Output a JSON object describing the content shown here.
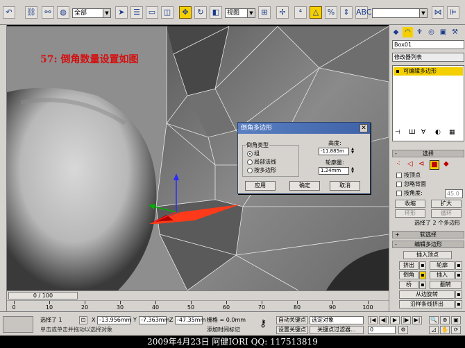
{
  "toolbar": {
    "selection_filter": "全部",
    "ref_coord": "视图",
    "named_selection": ""
  },
  "viewport": {
    "annotation": "57: 倒角数量设置如图"
  },
  "panel": {
    "object_name": "Box01",
    "modifier_list": "修改器列表",
    "stack_item": "可编辑多边形",
    "selection_rollout": "选择",
    "by_vertex": "按顶点",
    "ignore_backfacing": "忽略背面",
    "by_angle": "按角度:",
    "angle_value": "45.0",
    "shrink": "收缩",
    "grow": "扩大",
    "ring": "环形",
    "loop": "循环",
    "selected_info": "选择了 2 个多边形",
    "soft_selection": "软选择",
    "edit_polygons": "编辑多边形",
    "insert_vertex": "插入顶点",
    "extrude": "挤出",
    "outline": "轮廓",
    "bevel": "倒角",
    "inset": "插入",
    "bridge": "桥",
    "flip": "翻转",
    "hinge_from_edge": "从边旋转",
    "extrude_along_spline": "沿样条线挤出"
  },
  "dialog": {
    "title": "倒角多边形",
    "group_label": "倒角类型",
    "option_group": "组",
    "option_local_normal": "局部法线",
    "option_by_polygon": "按多边形",
    "height_label": "高度:",
    "height_value": "-11.885m",
    "outline_label": "轮廓量:",
    "outline_value": "1.24mm",
    "apply": "应用",
    "ok": "确定",
    "cancel": "取消"
  },
  "timeline": {
    "frame": "0 / 100",
    "ticks": [
      "0",
      "10",
      "20",
      "30",
      "40",
      "50",
      "60",
      "70",
      "80",
      "90",
      "100"
    ]
  },
  "status": {
    "selected": "选择了 1",
    "x_value": "-13.956mm",
    "y_value": "-7.363mm",
    "z_value": "-47.35mm",
    "grid": "栅格 = 0.0mm",
    "auto_key": "自动关键点",
    "set_key": "设置关键点",
    "key_filter_select": "选定对象",
    "key_filters": "关键点过滤器...",
    "add_time_tag": "添加时间标记",
    "prompt": "单击或单击并拖动以选择对象",
    "frame_value": "0"
  },
  "caption": "2009年4月23日  阿健IORI  QQ: 117513819"
}
